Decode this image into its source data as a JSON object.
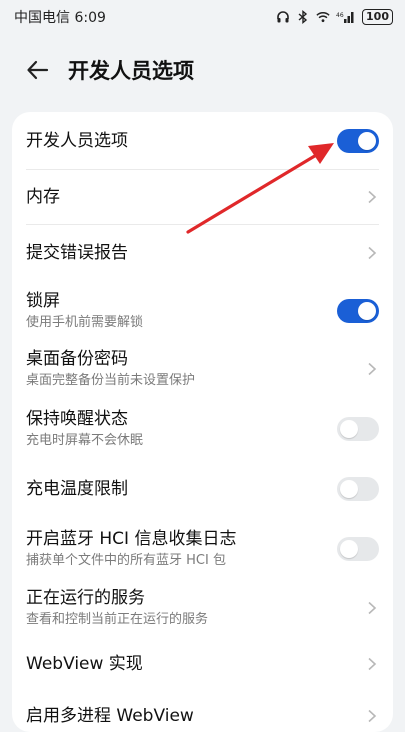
{
  "status_bar": {
    "carrier_time": "中国电信 6:09",
    "signal": "⁴⁶ill",
    "battery": "100"
  },
  "header": {
    "title": "开发人员选项"
  },
  "rows": [
    {
      "label": "开发人员选项",
      "sub": "",
      "control": "toggle",
      "on": true
    },
    {
      "label": "内存",
      "sub": "",
      "control": "chevron"
    },
    {
      "label": "提交错误报告",
      "sub": "",
      "control": "chevron"
    },
    {
      "label": "锁屏",
      "sub": "使用手机前需要解锁",
      "control": "toggle",
      "on": true
    },
    {
      "label": "桌面备份密码",
      "sub": "桌面完整备份当前未设置保护",
      "control": "chevron"
    },
    {
      "label": "保持唤醒状态",
      "sub": "充电时屏幕不会休眠",
      "control": "toggle",
      "on": false
    },
    {
      "label": "充电温度限制",
      "sub": "",
      "control": "toggle",
      "on": false
    },
    {
      "label": "开启蓝牙 HCI 信息收集日志",
      "sub": "捕获单个文件中的所有蓝牙 HCI 包",
      "control": "toggle",
      "on": false
    },
    {
      "label": "正在运行的服务",
      "sub": "查看和控制当前正在运行的服务",
      "control": "chevron"
    },
    {
      "label": "WebView 实现",
      "sub": "",
      "control": "chevron"
    },
    {
      "label": "启用多进程 WebView",
      "sub": "",
      "control": "chevron"
    }
  ],
  "colors": {
    "accent": "#1a5fd6",
    "annotation_arrow": "#e0282a"
  },
  "icons": {
    "back": "arrow-left-icon",
    "headphones": "headphones-icon",
    "bluetooth": "bluetooth-icon",
    "wifi": "wifi-icon",
    "signal": "cellular-signal-icon",
    "battery": "battery-icon"
  }
}
